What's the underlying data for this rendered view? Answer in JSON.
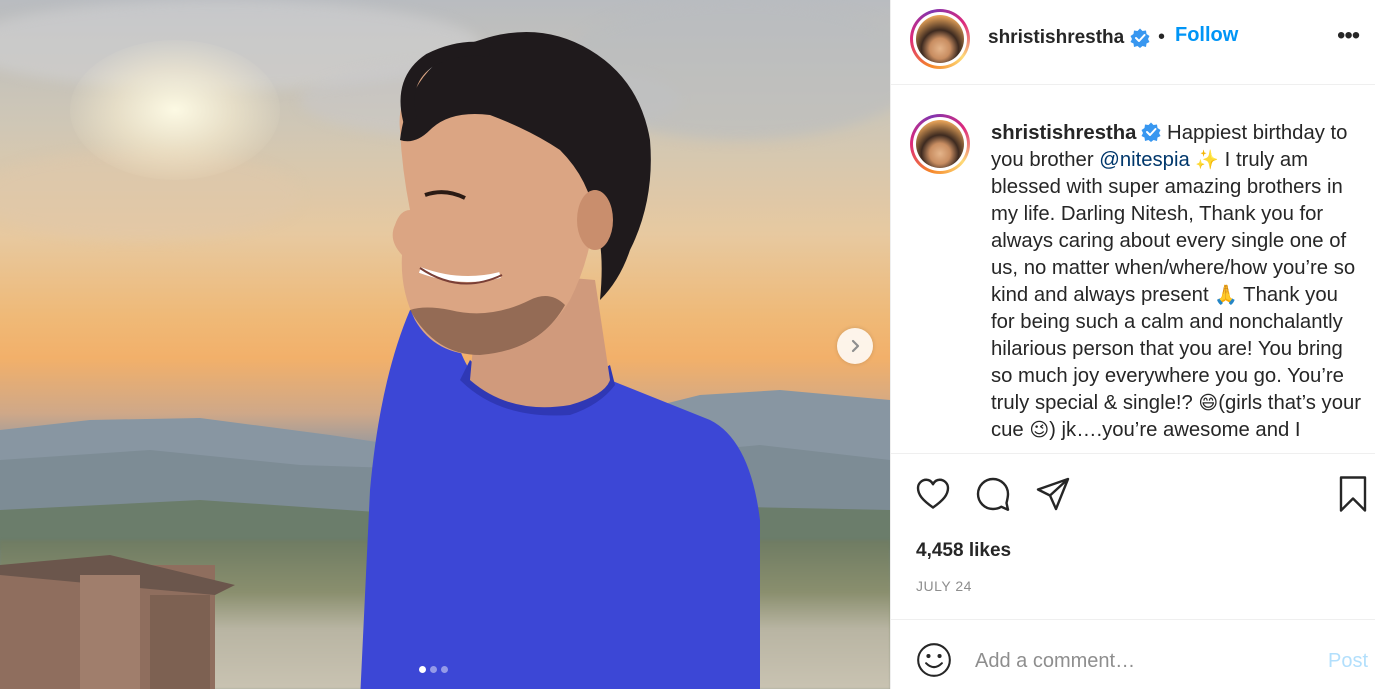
{
  "post": {
    "username": "shristishrestha",
    "follow_label": "Follow",
    "separator": "•",
    "more_label": "•••",
    "caption_parts": {
      "p1": " Happiest birthday to you brother ",
      "mention": "@nitespia",
      "emoji_sparkles": "✨",
      "p2": " I truly am blessed with super amazing brothers in my life. Darling Nitesh, Thank you for always caring about every single one of us, no matter when/where/how you’re so kind and always present ",
      "emoji_pray": "🙏",
      "p3": " Thank you for being such a calm and nonchalantly hilarious person that you are! You bring so much joy everywhere you go. You’re truly special & single!? ",
      "emoji_grin": "😄",
      "p4": "(girls that’s your cue ",
      "emoji_wink": "😉",
      "p5": ") jk….you’re awesome and I"
    },
    "likes": "4,458 likes",
    "date": "JULY 24",
    "comment_placeholder": "Add a comment…",
    "post_label": "Post",
    "carousel": {
      "total_slides": 3,
      "active_slide": 1
    }
  },
  "colors": {
    "accent": "#0095f6",
    "post_disabled": "#b2dffc",
    "verified": "#3897f0",
    "shirt": "#3c47d6"
  },
  "icons": [
    "verified-badge-icon",
    "more-options-icon",
    "heart-icon",
    "comment-icon",
    "share-icon",
    "bookmark-icon",
    "smiley-icon",
    "chevron-right-icon"
  ]
}
